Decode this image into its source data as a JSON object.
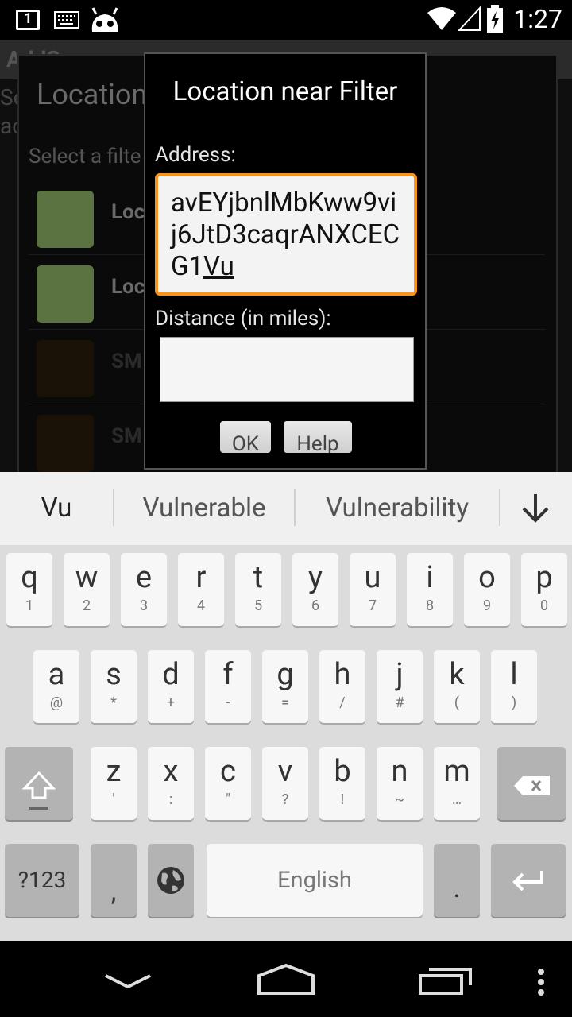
{
  "status_bar": {
    "time": "1:27",
    "notification_count": "1",
    "icons": [
      "notification-icon",
      "keyboard-icon",
      "cyanogen-android-icon",
      "wifi-icon",
      "signal-icon",
      "battery-charging-icon"
    ]
  },
  "background": {
    "action_bar_title": "AddS",
    "left_text": [
      "Se",
      "ac"
    ],
    "dialog_title": "Location",
    "dialog_subtitle": "Select a filte          nto [Location]:          filter on:",
    "rows": [
      {
        "label": "Loca",
        "color": "#5a7340",
        "text_color": "#6a6a6a"
      },
      {
        "label": "Loca",
        "color": "#5a7340",
        "text_color": "#6a6a6a"
      },
      {
        "label": "SM",
        "color": "#1a1206",
        "text_color": "#2a2a2a"
      },
      {
        "label": "SM",
        "color": "#1a1206",
        "text_color": "#2a2a2a"
      }
    ]
  },
  "dialog": {
    "title": "Location near Filter",
    "address_label": "Address:",
    "address_value": "avEYjbnlMbKww9vij6JtD3caqrANXCECG1",
    "address_composing": "Vu",
    "distance_label": "Distance (in miles):",
    "distance_value": "",
    "ok_label": "OK",
    "help_label": "Help"
  },
  "suggestions": {
    "items": [
      "Vu",
      "Vulnerable",
      "Vulnerability"
    ],
    "collapse_icon": "arrow-down-icon"
  },
  "keyboard": {
    "row1": [
      [
        "q",
        "1"
      ],
      [
        "w",
        "2"
      ],
      [
        "e",
        "3"
      ],
      [
        "r",
        "4"
      ],
      [
        "t",
        "5"
      ],
      [
        "y",
        "6"
      ],
      [
        "u",
        "7"
      ],
      [
        "i",
        "8"
      ],
      [
        "o",
        "9"
      ],
      [
        "p",
        "0"
      ]
    ],
    "row2": [
      [
        "a",
        "@"
      ],
      [
        "s",
        "*"
      ],
      [
        "d",
        "+"
      ],
      [
        "f",
        "-"
      ],
      [
        "g",
        "="
      ],
      [
        "h",
        "/"
      ],
      [
        "j",
        "#"
      ],
      [
        "k",
        "("
      ],
      [
        "l",
        ")"
      ]
    ],
    "row3": [
      [
        "z",
        "'"
      ],
      [
        "x",
        ":"
      ],
      [
        "c",
        "\""
      ],
      [
        "v",
        "?"
      ],
      [
        "b",
        "!"
      ],
      [
        "n",
        "~"
      ],
      [
        "m",
        "…"
      ]
    ],
    "symbols_label": "?123",
    "comma_label": ",",
    "space_label": "English",
    "period_label": ".",
    "accent_color": "#f7931e"
  }
}
